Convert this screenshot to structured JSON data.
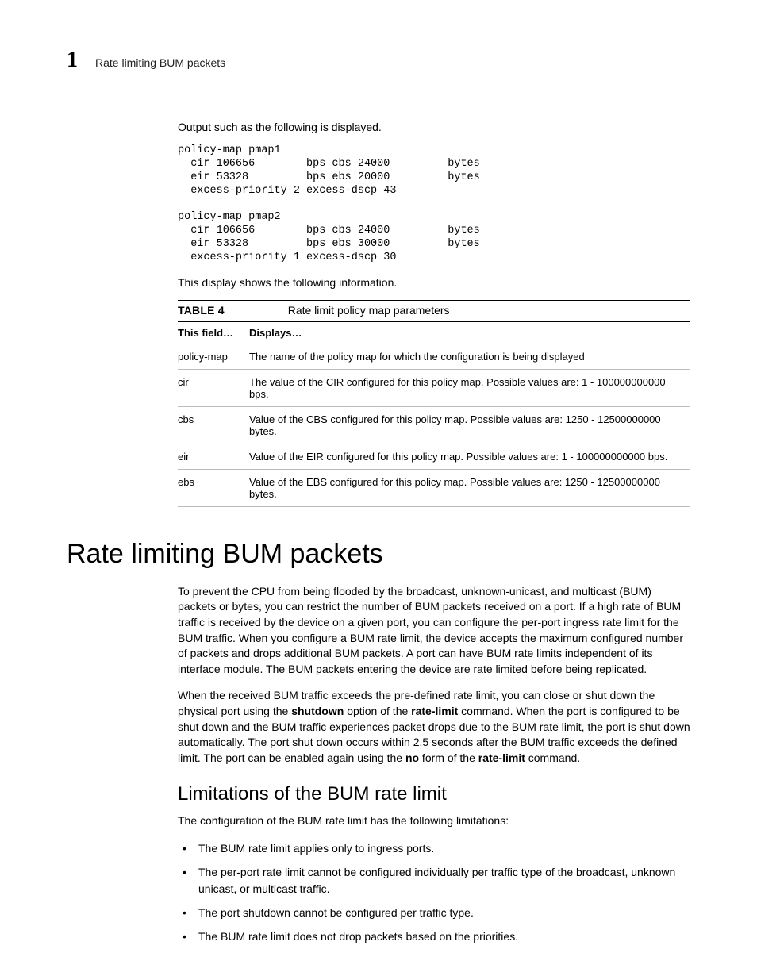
{
  "header": {
    "chapter_number": "1",
    "title": "Rate limiting BUM packets"
  },
  "intro": "Output such as the following is displayed.",
  "code_output": "policy-map pmap1\n  cir 106656        bps cbs 24000         bytes\n  eir 53328         bps ebs 20000         bytes\n  excess-priority 2 excess-dscp 43\n\npolicy-map pmap2\n  cir 106656        bps cbs 24000         bytes\n  eir 53328         bps ebs 30000         bytes\n  excess-priority 1 excess-dscp 30",
  "post_code": "This display shows the following information.",
  "table": {
    "label": "TABLE 4",
    "caption": "Rate limit policy map parameters",
    "head_field": "This field…",
    "head_displays": "Displays…",
    "rows": [
      {
        "field": "policy-map",
        "desc": "The name of the policy map for which the configuration is being displayed"
      },
      {
        "field": "cir",
        "desc": "The value of the CIR configured for this policy map. Possible values are: 1 - 100000000000 bps."
      },
      {
        "field": "cbs",
        "desc": "Value of the CBS configured for this policy map. Possible values are: 1250 - 12500000000 bytes."
      },
      {
        "field": "eir",
        "desc": "Value of the EIR configured for this policy map. Possible values are: 1 - 100000000000 bps."
      },
      {
        "field": "ebs",
        "desc": "Value of the EBS configured for this policy map. Possible values are: 1250 - 12500000000 bytes."
      }
    ]
  },
  "section": {
    "title": "Rate limiting BUM packets",
    "para1": "To prevent the CPU from being flooded by the broadcast, unknown-unicast, and multicast (BUM) packets or bytes, you can restrict the number of BUM packets received on a port. If a high rate of BUM traffic is received by the device on a given port, you can configure the per-port ingress rate limit for the BUM traffic. When you configure a BUM rate limit, the device accepts the maximum configured number of packets and drops additional BUM packets. A port can have BUM rate limits independent of its interface module. The BUM packets entering the device are rate limited before being replicated.",
    "para2_a": "When the received BUM traffic exceeds the pre-defined rate limit, you can close or shut down the physical port using the ",
    "para2_b1": "shutdown",
    "para2_c": " option of the ",
    "para2_b2": "rate-limit",
    "para2_d": " command. When the port is configured to be shut down and the BUM traffic experiences packet drops due to the BUM rate limit, the port is shut down automatically. The port shut down occurs within 2.5 seconds after the BUM traffic exceeds the defined limit. The port can be enabled again using the ",
    "para2_b3": "no",
    "para2_e": " form of the ",
    "para2_b4": "rate-limit",
    "para2_f": " command."
  },
  "subsection": {
    "title": "Limitations of the BUM rate limit",
    "intro": "The configuration of the BUM rate limit has the following limitations:",
    "bullets": [
      "The BUM rate limit applies only to ingress ports.",
      "The per-port rate limit cannot be configured individually per traffic type of the broadcast, unknown unicast, or multicast traffic.",
      "The port shutdown cannot be configured per traffic type.",
      "The BUM rate limit does not drop packets based on the priorities."
    ]
  }
}
